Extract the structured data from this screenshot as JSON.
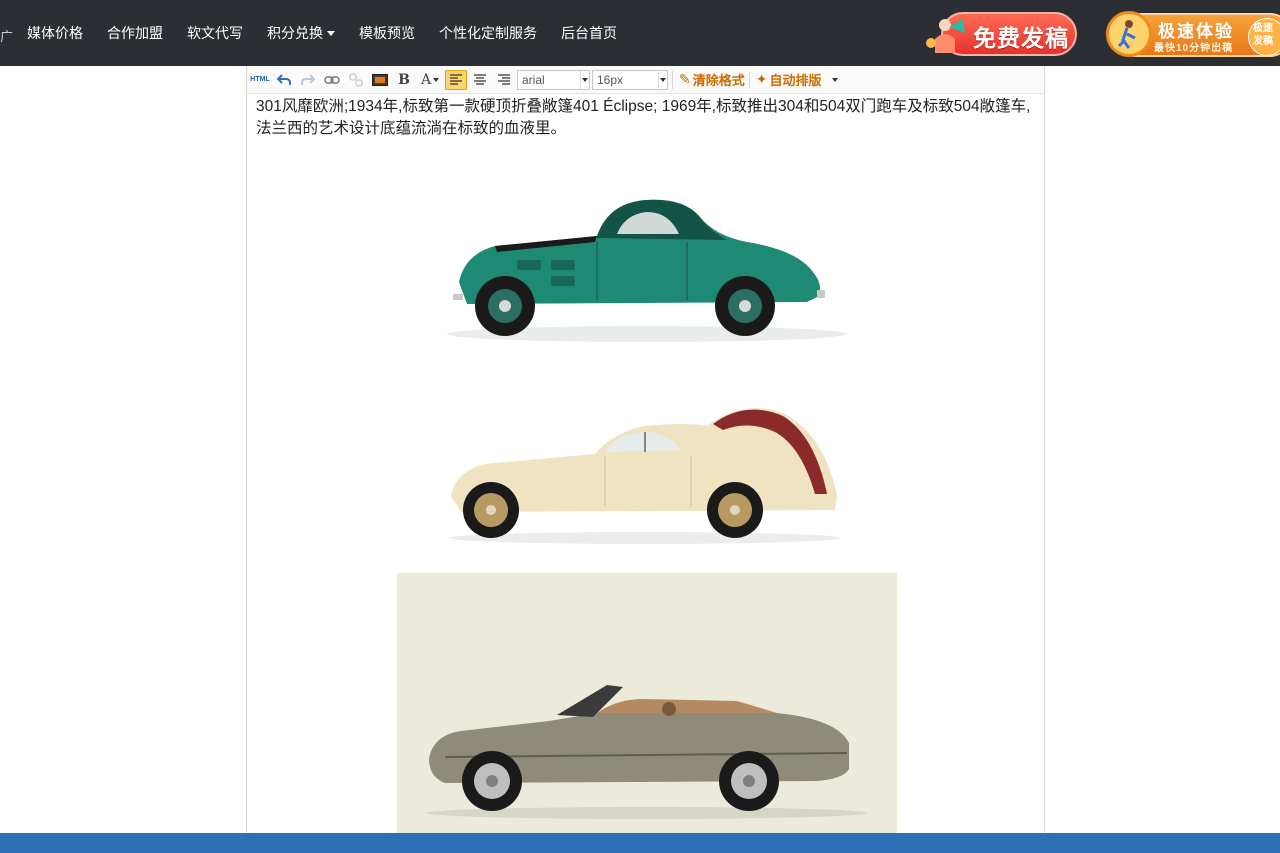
{
  "nav": {
    "edge_fragment": "广",
    "items": [
      {
        "label": "媒体价格"
      },
      {
        "label": "合作加盟"
      },
      {
        "label": "软文代写"
      },
      {
        "label": "积分兑换",
        "has_dropdown": true
      },
      {
        "label": "模板预览"
      },
      {
        "label": "个性化定制服务"
      },
      {
        "label": "后台首页"
      }
    ],
    "promo_free_label": "免费发稿",
    "promo_fast_title": "极速体验",
    "promo_fast_sub": "最快10分钟出稿",
    "promo_fast_tail": "极速发稿"
  },
  "toolbar": {
    "html_label": "HTML",
    "bold_label": "B",
    "font_color_label": "A",
    "font_family": "arial",
    "font_size": "16px",
    "clear_format_label": "清除格式",
    "auto_layout_label": "自动排版"
  },
  "content": {
    "paragraph": "301风靡欧洲;1934年,标致第一款硬顶折叠敞篷401 Éclipse; 1969年,标致推出304和504双门跑车及标致504敞篷车,法兰西的艺术设计底蕴流淌在标致的血液里。"
  },
  "colors": {
    "nav_bg": "#2b2e33",
    "footer_bar": "#2f6fb5",
    "accent_orange": "#cc6c00",
    "car1_body": "#1f8a73",
    "car2_body": "#efe3c1",
    "car3_body": "#8e8c78",
    "car3_bg": "#eceadb"
  }
}
